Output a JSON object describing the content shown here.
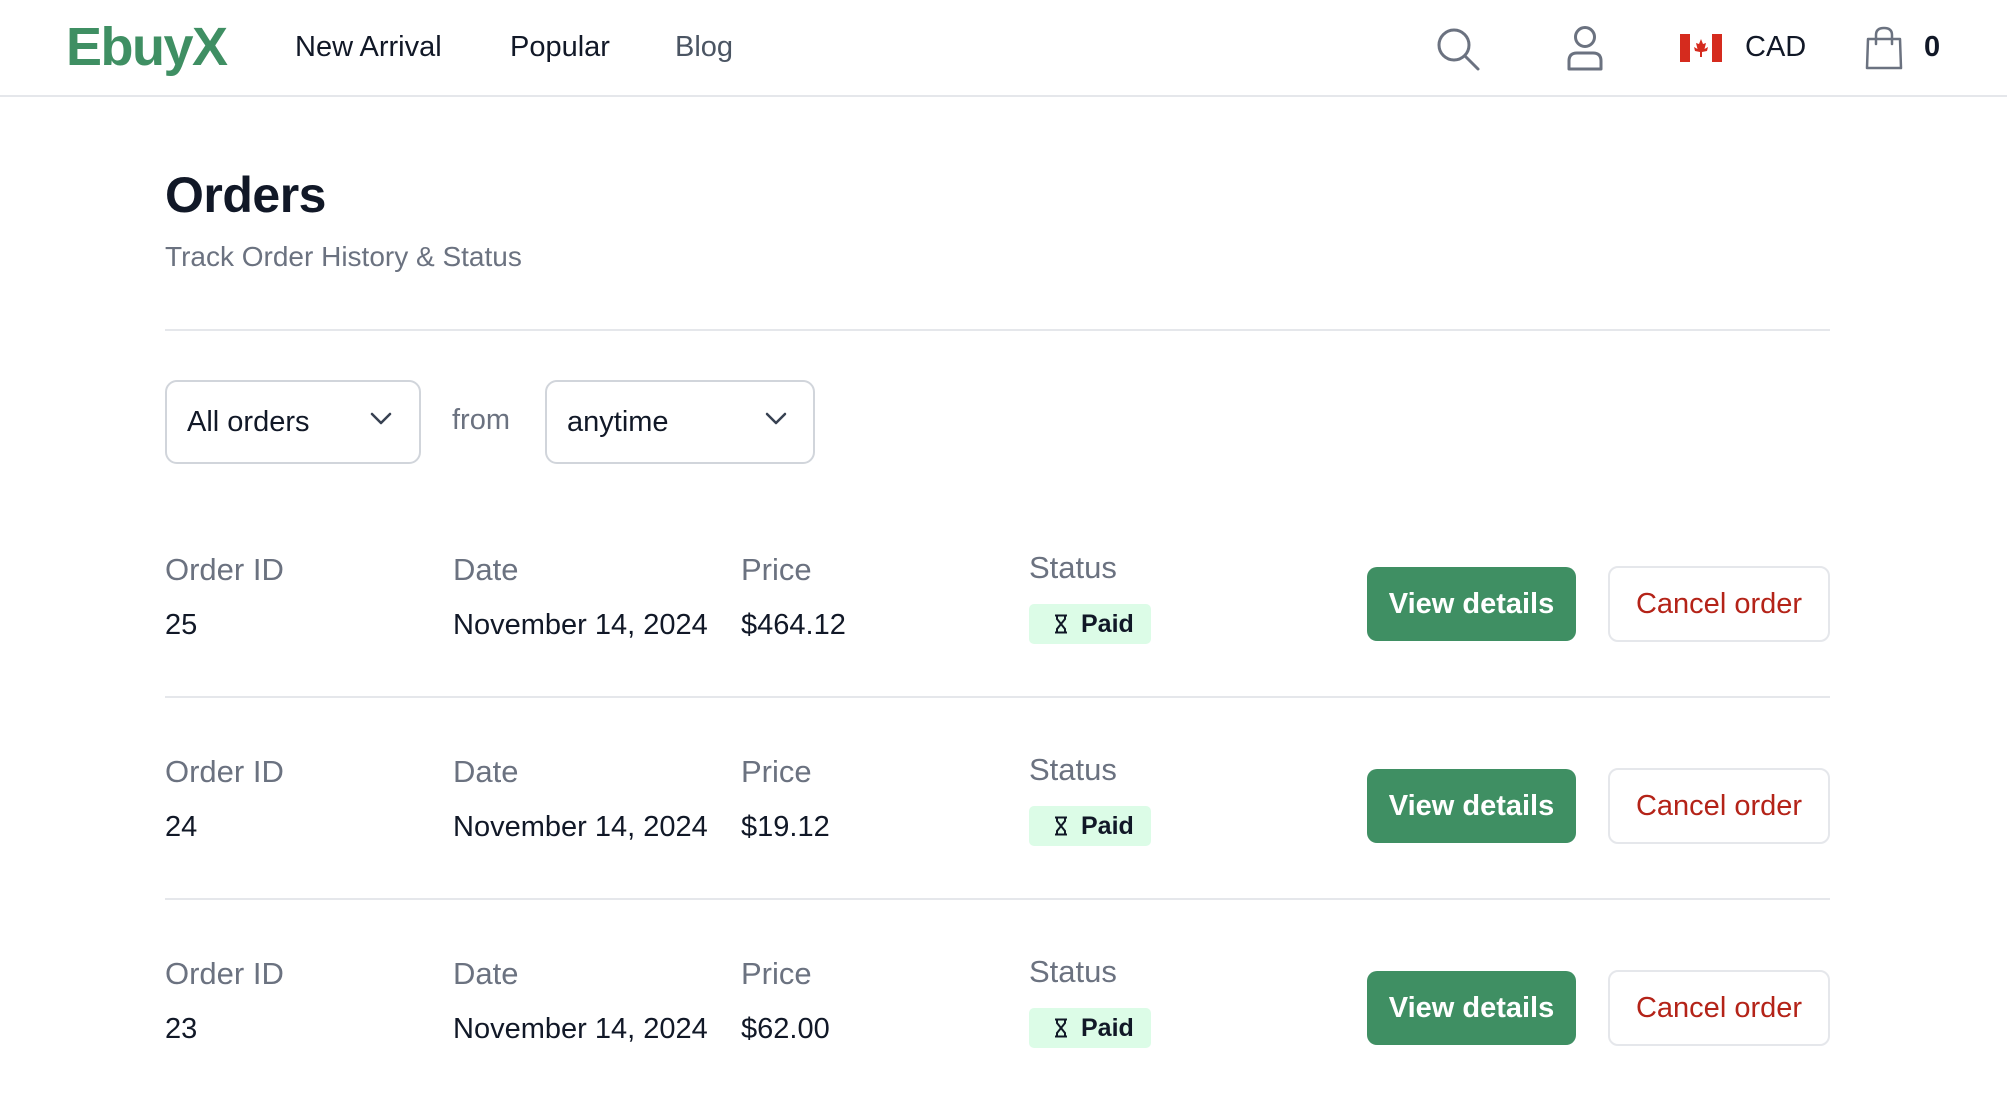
{
  "header": {
    "logo": "EbuyX",
    "nav": [
      {
        "label": "New Arrival"
      },
      {
        "label": "Popular"
      },
      {
        "label": "Blog"
      }
    ],
    "icons": {
      "search": "search-icon",
      "user": "user-icon",
      "flag": "canada-flag-icon",
      "cart": "shopping-bag-icon"
    },
    "currency": "CAD",
    "cart_count": "0"
  },
  "page": {
    "title": "Orders",
    "subtitle": "Track Order History & Status"
  },
  "filters": {
    "status_select": {
      "value": "All orders",
      "icon": "chevron-down-icon"
    },
    "from_label": "from",
    "time_select": {
      "value": "anytime",
      "icon": "chevron-down-icon"
    }
  },
  "labels": {
    "order_id": "Order ID",
    "date": "Date",
    "price": "Price",
    "status": "Status",
    "view_details": "View details",
    "cancel_order": "Cancel order"
  },
  "orders": [
    {
      "id": "25",
      "date": "November 14, 2024",
      "price": "$464.12",
      "status": "Paid",
      "status_icon": "hourglass-icon"
    },
    {
      "id": "24",
      "date": "November 14, 2024",
      "price": "$19.12",
      "status": "Paid",
      "status_icon": "hourglass-icon"
    },
    {
      "id": "23",
      "date": "November 14, 2024",
      "price": "$62.00",
      "status": "Paid",
      "status_icon": "hourglass-icon"
    }
  ],
  "colors": {
    "brand_green": "#3f8f63",
    "paid_badge_bg": "#dcfce7",
    "cancel_red": "#b42318",
    "muted_text": "#6b7280",
    "border": "#e5e7eb"
  }
}
